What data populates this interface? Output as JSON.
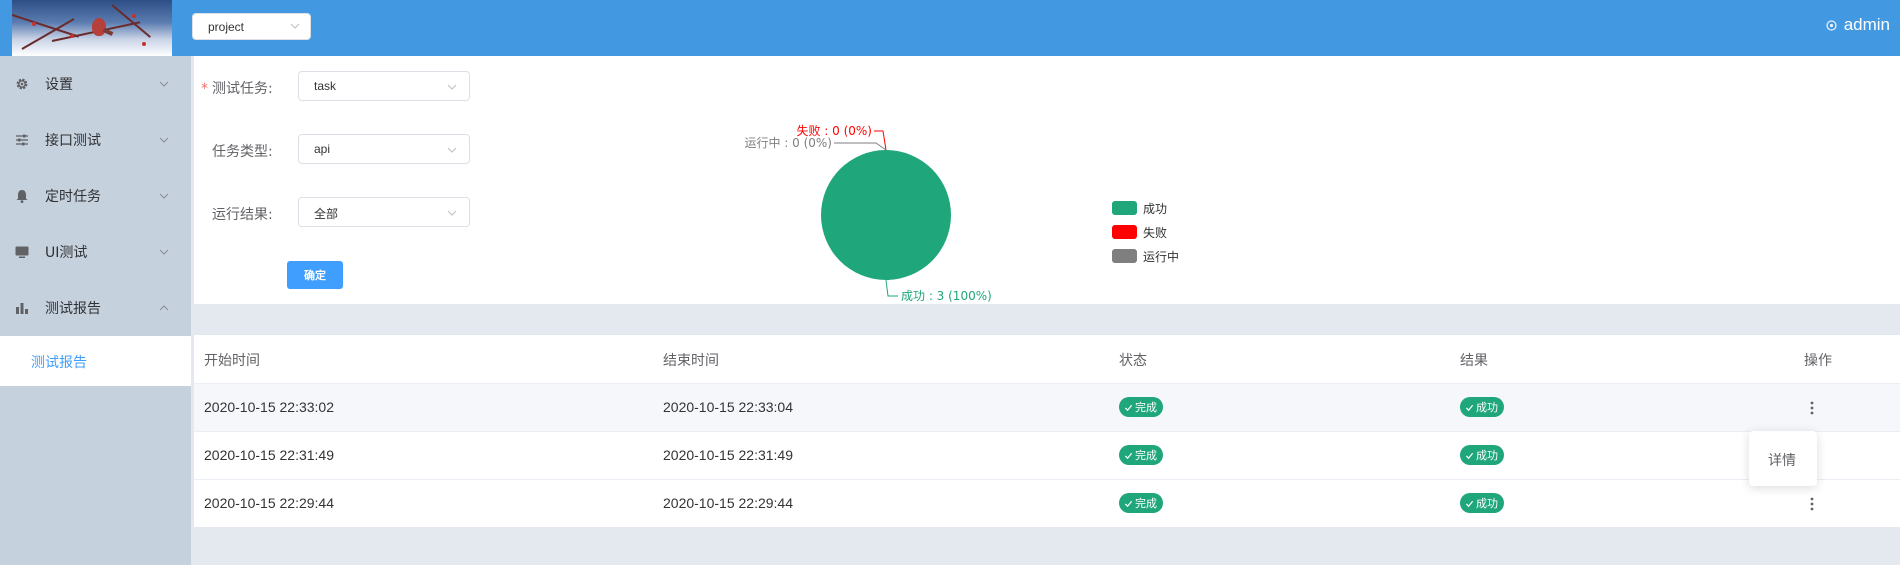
{
  "header": {
    "project_value": "project",
    "user_name": "admin"
  },
  "sidebar": {
    "items": [
      {
        "label": "设置",
        "icon": "gear-icon"
      },
      {
        "label": "接口测试",
        "icon": "sliders-icon"
      },
      {
        "label": "定时任务",
        "icon": "bell-icon"
      },
      {
        "label": "UI测试",
        "icon": "monitor-icon"
      },
      {
        "label": "测试报告",
        "icon": "bar-chart-icon"
      }
    ],
    "sub_item": "测试报告"
  },
  "filters": {
    "task_label": "测试任务:",
    "task_required": "*",
    "task_value": "task",
    "type_label": "任务类型:",
    "type_value": "api",
    "result_label": "运行结果:",
    "result_value": "全部",
    "confirm_label": "确定"
  },
  "chart_data": {
    "type": "pie",
    "slices": [
      {
        "name": "成功",
        "value": 3,
        "percent": "100%",
        "color": "#1fa67a",
        "label": "成功 : 3 (100%)"
      },
      {
        "name": "失败",
        "value": 0,
        "percent": "0%",
        "color": "#ff0000",
        "label": "失败 : 0 (0%)"
      },
      {
        "name": "运行中",
        "value": 0,
        "percent": "0%",
        "color": "#7f7f7f",
        "label": "运行中 : 0 (0%)"
      }
    ],
    "legend": [
      "成功",
      "失败",
      "运行中"
    ],
    "legend_position": "right"
  },
  "table": {
    "headers": [
      "开始时间",
      "结束时间",
      "状态",
      "结果",
      "操作"
    ],
    "rows": [
      {
        "start": "2020-10-15 22:33:02",
        "end": "2020-10-15 22:33:04",
        "status": "完成",
        "result": "成功"
      },
      {
        "start": "2020-10-15 22:31:49",
        "end": "2020-10-15 22:31:49",
        "status": "完成",
        "result": "成功"
      },
      {
        "start": "2020-10-15 22:29:44",
        "end": "2020-10-15 22:29:44",
        "status": "完成",
        "result": "成功"
      }
    ]
  },
  "dropdown": {
    "item": "详情"
  },
  "colors": {
    "header_bg": "#4299e1",
    "sidebar_bg": "#c6d1de",
    "accent": "#409eff",
    "success": "#1fa67a",
    "error": "#ff0000",
    "running": "#7f7f7f"
  }
}
